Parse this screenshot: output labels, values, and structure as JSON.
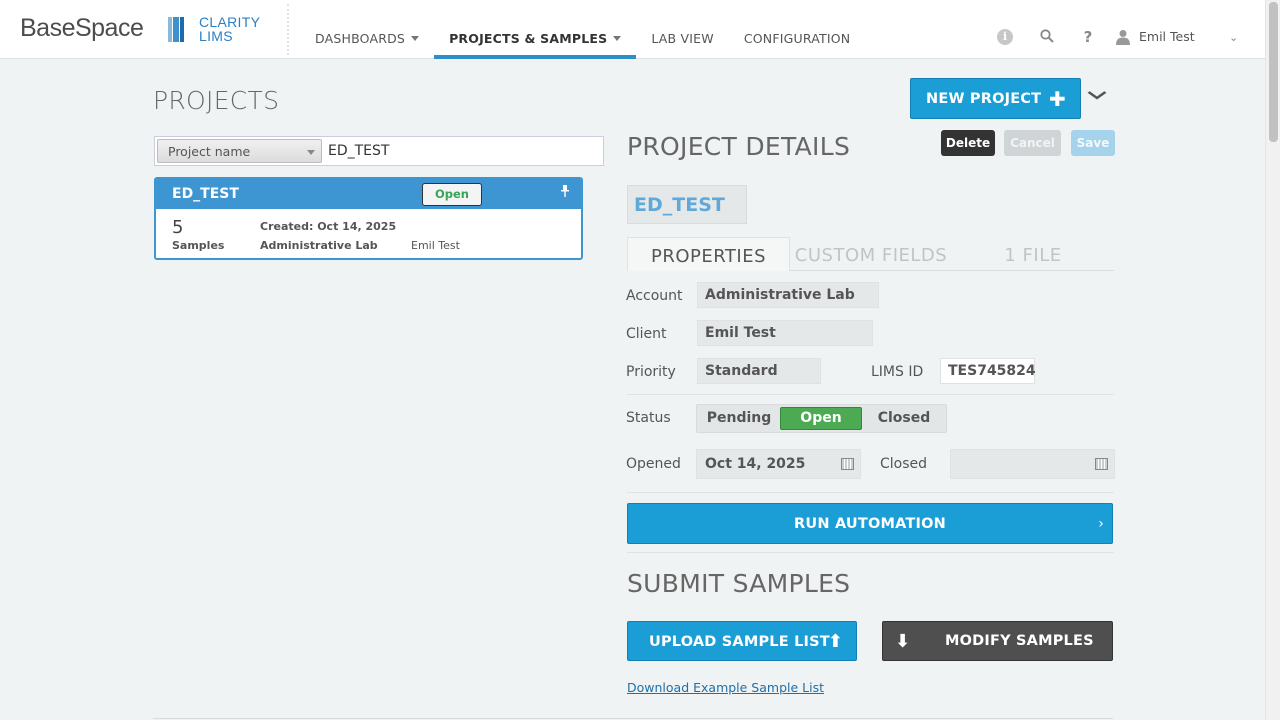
{
  "brand": {
    "name": "BaseSpace",
    "product_line1": "CLARITY",
    "product_line2": "LIMS"
  },
  "nav": {
    "items": [
      {
        "label": "DASHBOARDS",
        "has_dropdown": true,
        "active": false
      },
      {
        "label": "PROJECTS & SAMPLES",
        "has_dropdown": true,
        "active": true
      },
      {
        "label": "LAB VIEW",
        "has_dropdown": false,
        "active": false
      },
      {
        "label": "CONFIGURATION",
        "has_dropdown": false,
        "active": false
      }
    ]
  },
  "header_icons": {
    "info": "i",
    "search": "⌕",
    "help": "?",
    "user": "👤"
  },
  "user": {
    "name": "Emil Test",
    "menu_icon": "⌄"
  },
  "projects": {
    "title": "PROJECTS",
    "search_field": "Project name",
    "search_value": "ED_TEST",
    "list": [
      {
        "name": "ED_TEST",
        "status": "Open",
        "sample_count": "5",
        "sample_label": "Samples",
        "created": "Created: Oct 14, 2025",
        "account": "Administrative Lab",
        "owner": "Emil Test"
      }
    ]
  },
  "actions": {
    "new_project": "NEW PROJECT",
    "new_project_icon": "✚",
    "collapse_icon": "⌄"
  },
  "details": {
    "title": "PROJECT DETAILS",
    "delete": "Delete",
    "cancel": "Cancel",
    "save": "Save",
    "project_name": "ED_TEST",
    "tabs": [
      "PROPERTIES",
      "CUSTOM FIELDS",
      "1 FILE"
    ],
    "account_label": "Account",
    "account": "Administrative Lab",
    "client_label": "Client",
    "client": "Emil Test",
    "priority_label": "Priority",
    "priority": "Standard",
    "lims_id_label": "LIMS ID",
    "lims_id": "TES745824",
    "status_label": "Status",
    "status_options": [
      "Pending",
      "Open",
      "Closed"
    ],
    "status_selected": "Open",
    "opened_label": "Opened",
    "opened": "Oct 14, 2025",
    "closed_label": "Closed",
    "closed": ""
  },
  "run_automation": {
    "label": "RUN AUTOMATION",
    "icon": "›"
  },
  "submit": {
    "title": "SUBMIT SAMPLES",
    "upload": "UPLOAD SAMPLE LIST",
    "upload_icon": "⬆",
    "modify": "MODIFY SAMPLES",
    "modify_icon": "⬇",
    "download_link": "Download Example Sample List"
  },
  "colors": {
    "accent": "#1b9dd6",
    "open_status": "#4caa53",
    "card_header": "#3d95d2"
  }
}
